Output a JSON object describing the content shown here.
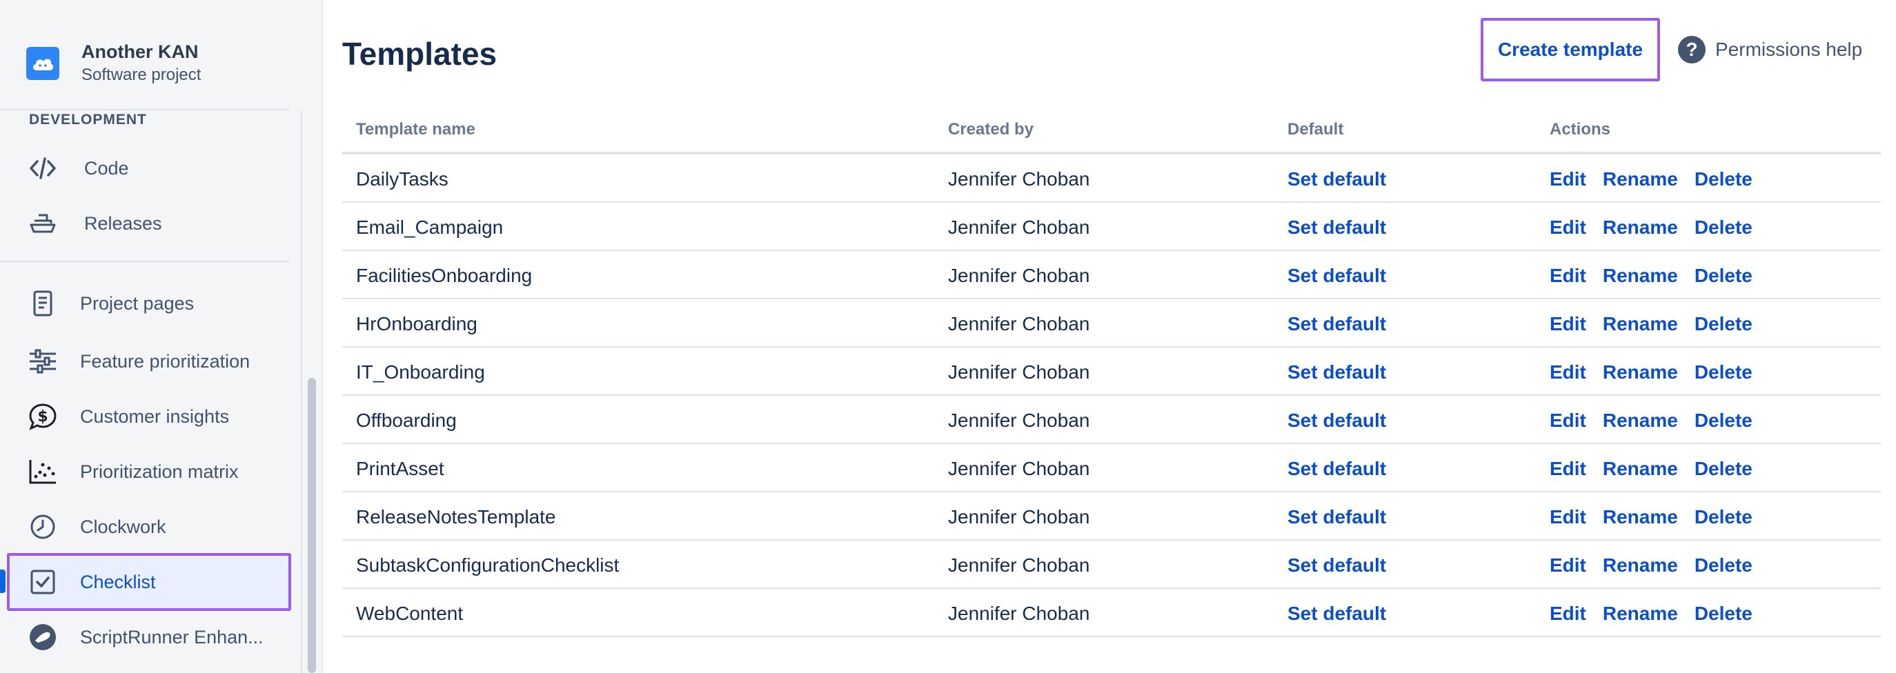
{
  "project": {
    "name": "Another KAN",
    "type": "Software project"
  },
  "sidebar": {
    "section_header": "DEVELOPMENT",
    "items": [
      {
        "label": "Code",
        "icon": "code-icon"
      },
      {
        "label": "Releases",
        "icon": "ship-icon"
      },
      {
        "label": "Project pages",
        "icon": "page-icon"
      },
      {
        "label": "Feature prioritization",
        "icon": "sliders-icon"
      },
      {
        "label": "Customer insights",
        "icon": "dollar-chat-icon"
      },
      {
        "label": "Prioritization matrix",
        "icon": "scatter-icon"
      },
      {
        "label": "Clockwork",
        "icon": "clock-icon"
      },
      {
        "label": "Checklist",
        "icon": "checkbox-icon",
        "selected": true
      },
      {
        "label": "ScriptRunner Enhan...",
        "icon": "scriptrunner-icon"
      }
    ]
  },
  "header": {
    "title": "Templates",
    "create_label": "Create template",
    "help_label": "Permissions help"
  },
  "table": {
    "columns": [
      "Template name",
      "Created by",
      "Default",
      "Actions"
    ],
    "action_labels": {
      "set_default": "Set default",
      "edit": "Edit",
      "rename": "Rename",
      "delete": "Delete"
    },
    "rows": [
      {
        "name": "DailyTasks",
        "created_by": "Jennifer Choban"
      },
      {
        "name": "Email_Campaign",
        "created_by": "Jennifer Choban"
      },
      {
        "name": "FacilitiesOnboarding",
        "created_by": "Jennifer Choban"
      },
      {
        "name": "HrOnboarding",
        "created_by": "Jennifer Choban"
      },
      {
        "name": "IT_Onboarding",
        "created_by": "Jennifer Choban"
      },
      {
        "name": "Offboarding",
        "created_by": "Jennifer Choban"
      },
      {
        "name": "PrintAsset",
        "created_by": "Jennifer Choban"
      },
      {
        "name": "ReleaseNotesTemplate",
        "created_by": "Jennifer Choban"
      },
      {
        "name": "SubtaskConfigurationChecklist",
        "created_by": "Jennifer Choban"
      },
      {
        "name": "WebContent",
        "created_by": "Jennifer Choban"
      }
    ]
  },
  "colors": {
    "link": "#0c4fc4",
    "highlight": "#9b5de5",
    "text": "#172b4d",
    "selected_bg": "#e9efff"
  }
}
